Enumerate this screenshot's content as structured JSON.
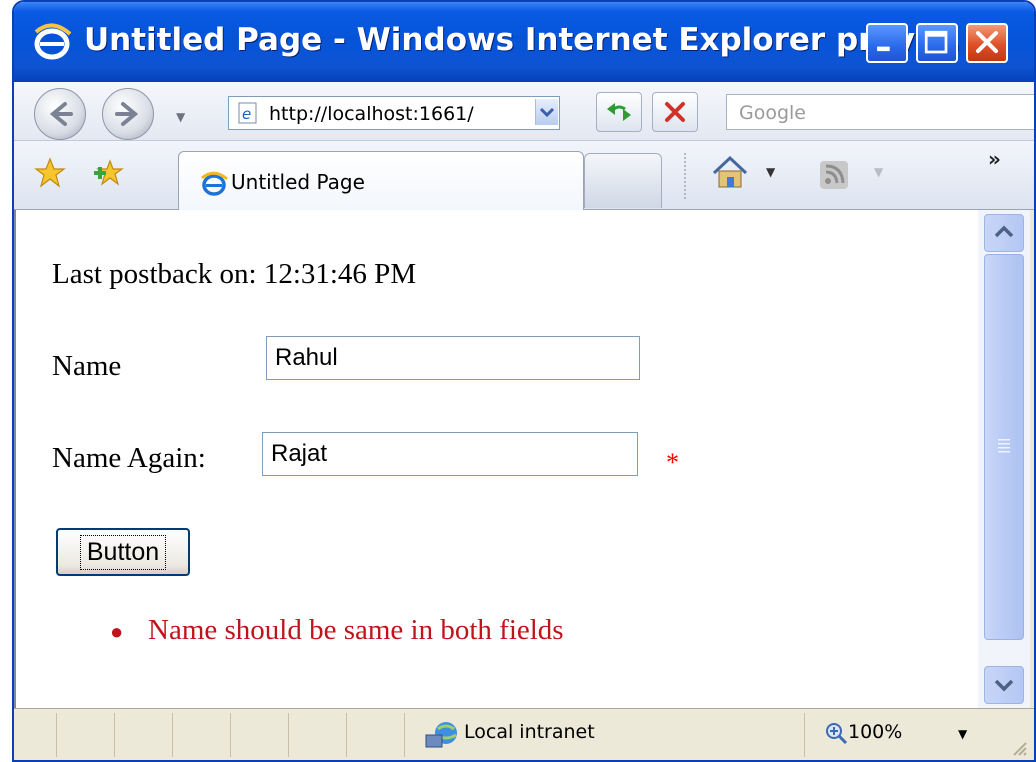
{
  "window": {
    "title": "Untitled Page - Windows Internet Explorer provi..."
  },
  "nav": {
    "address": "http://localhost:1661/",
    "search_placeholder": "Google"
  },
  "tabs": [
    {
      "label": "Untitled Page"
    }
  ],
  "page": {
    "last_postback": "Last postback on: 12:31:46 PM",
    "name_label": "Name",
    "name_value": "Rahul",
    "name_again_label": "Name Again:",
    "name_again_value": "Rajat",
    "required_marker": "*",
    "button_label": "Button",
    "errors": [
      "Name should be same in both fields"
    ]
  },
  "status": {
    "zone": "Local intranet",
    "zoom": "100%"
  },
  "colors": {
    "title_bar": "#0554d8",
    "error_text": "#c0141c",
    "required_marker": "#ff0000"
  },
  "icons": {
    "title": "ie-logo-icon",
    "back": "back-arrow-icon",
    "forward": "forward-arrow-icon",
    "refresh": "refresh-icon",
    "stop": "stop-icon",
    "favorites": "favorites-star-icon",
    "add_favorite": "add-favorite-icon",
    "home": "home-icon",
    "feeds": "feeds-icon",
    "zone": "local-intranet-icon",
    "zoom": "zoom-icon"
  }
}
